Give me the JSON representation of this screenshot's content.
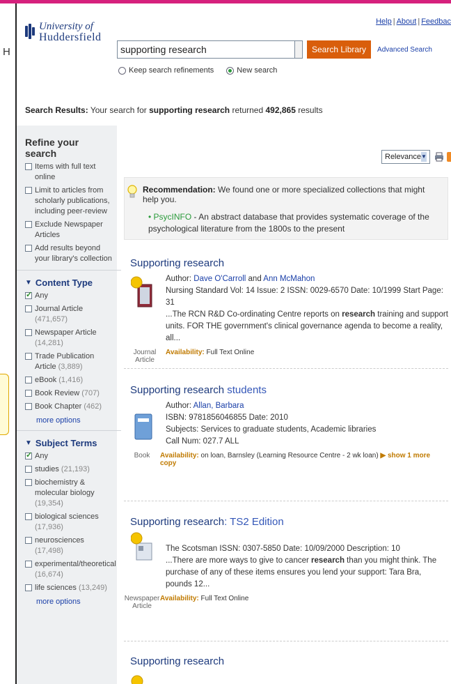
{
  "header": {
    "logo_line1": "University of",
    "logo_line2": "Huddersfield",
    "help": "Help",
    "about": "About",
    "feedback": "Feedbac",
    "sep": "|"
  },
  "side": {
    "h_fragment": "H"
  },
  "search": {
    "value": "supporting research",
    "button": "Search Library",
    "advanced": "Advanced Search",
    "radio_keep": "Keep search refinements",
    "radio_new": "New search"
  },
  "summary": {
    "label": "Search Results:",
    "prefix": " Your search for ",
    "term": "supporting research",
    "mid": " returned ",
    "count": "492,865",
    "suffix": " results"
  },
  "refine": {
    "title": "Refine your search",
    "options": [
      "Items with full text online",
      "Limit to articles from scholarly publications, including peer-review",
      "Exclude Newspaper Articles",
      "Add results beyond your library's collection"
    ]
  },
  "content_type": {
    "title": "Content Type",
    "items": [
      {
        "label": "Any",
        "count": ""
      },
      {
        "label": "Journal Article ",
        "count": "(471,657)"
      },
      {
        "label": "Newspaper Article ",
        "count": "(14,281)"
      },
      {
        "label": "Trade Publication Article ",
        "count": "(3,889)"
      },
      {
        "label": "eBook ",
        "count": "(1,416)"
      },
      {
        "label": "Book Review ",
        "count": "(707)"
      },
      {
        "label": "Book Chapter ",
        "count": "(462)"
      }
    ],
    "more": "more options"
  },
  "subject_terms": {
    "title": "Subject Terms",
    "items": [
      {
        "label": "Any",
        "count": ""
      },
      {
        "label": "studies ",
        "count": "(21,193)"
      },
      {
        "label": "biochemistry & molecular biology ",
        "count": "(19,354)"
      },
      {
        "label": "biological sciences ",
        "count": "(17,936)"
      },
      {
        "label": "neurosciences ",
        "count": "(17,498)"
      },
      {
        "label": "experimental/theoretical ",
        "count": "(16,674)"
      },
      {
        "label": "life sciences ",
        "count": "(13,249)"
      }
    ],
    "more": "more options"
  },
  "sort": {
    "value": "Relevance"
  },
  "recommendation": {
    "label": "Recommendation:",
    "text": " We found one or more specialized collections that might help you.",
    "item_link": "PsycINFO",
    "item_text": " - An abstract database that provides systematic coverage of the psychological literature from the 1800s to the present"
  },
  "results": [
    {
      "title_bold": "Supporting research",
      "title_rest": "",
      "author_label": "Author: ",
      "author1": "Dave O'Carroll",
      "author_and": " and ",
      "author2": "Ann McMahon",
      "meta": "Nursing Standard Vol: 14 Issue: 2 ISSN: 0029-6570 Date: 10/1999 Start Page: 31",
      "snip_pre": "...The RCN R&D Co-ordinating Centre reports on ",
      "snip_bold": "research",
      "snip_post": " training and support units. FOR THE government's clinical governance agenda to become a reality, all...",
      "type": "Journal Article",
      "avail_label": "Availability:",
      "avail_text": " Full Text Online",
      "badge": "Full text"
    },
    {
      "title_bold": "Supporting research",
      "title_rest": " students",
      "author_label": "Author: ",
      "author1": "Allan, Barbara",
      "isbn": "ISBN: 9781856046855 Date: 2010",
      "subjects": "Subjects: Services to graduate students, Academic libraries",
      "callnum": "Call Num: 027.7 ALL",
      "type": "Book",
      "avail_label": "Availability:",
      "avail_text": " on loan, Barnsley (Learning Resource Centre - 2 wk loan) ",
      "show_more": "▶ show 1 more copy"
    },
    {
      "title_bold": "Supporting research",
      "title_rest": ": TS2 Edition",
      "meta": "The Scotsman ISSN: 0307-5850 Date: 10/09/2000 Description: 10",
      "snip_pre": "...There are more ways to give to cancer ",
      "snip_bold": "research",
      "snip_post": " than you might think. The purchase of any of these items ensures you lend your support: Tara Bra, pounds 12...",
      "type": "Newspaper Article",
      "avail_label": "Availability:",
      "avail_text": " Full Text Online",
      "badge": "Full text"
    },
    {
      "title_bold": "Supporting research",
      "title_rest": ""
    }
  ],
  "colors": {
    "accent_bar": "#d6217d",
    "search_button": "#d95e0b",
    "title_blue": "#1d3a7d",
    "link_green": "#2a9a3a",
    "availability": "#c07a00"
  }
}
